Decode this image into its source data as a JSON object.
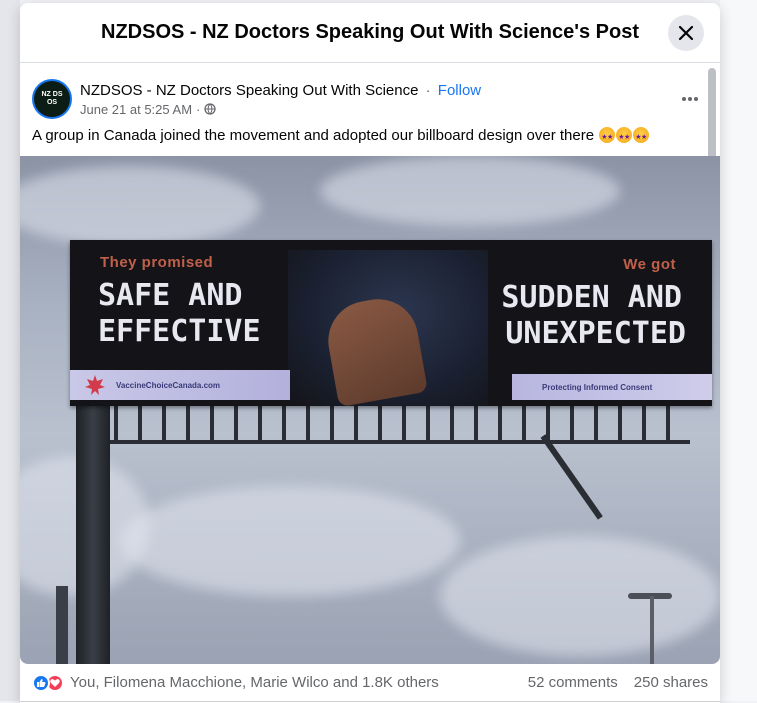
{
  "modal": {
    "title": "NZDSOS - NZ Doctors Speaking Out With Science's Post"
  },
  "post": {
    "author": "NZDSOS - NZ Doctors Speaking Out With Science",
    "separator": "·",
    "follow_label": "Follow",
    "timestamp": "June 21 at 5:25 AM",
    "meta_separator": "·",
    "text": "A group in Canada joined the movement and adopted our billboard design over there",
    "emoji_count": 3,
    "avatar_text": "NZ DS OS"
  },
  "billboard": {
    "left_small": "They promised",
    "left_big_1": "SAFE AND",
    "left_big_2": "EFFECTIVE",
    "right_small": "We got",
    "right_big_1": "SUDDEN AND",
    "right_big_2": "UNEXPECTED",
    "left_strip": "VaccineChoiceCanada.com",
    "right_strip": "Protecting Informed Consent"
  },
  "footer": {
    "reactors": "You, Filomena Macchione, Marie Wilco and 1.8K others",
    "comments": "52 comments",
    "shares": "250 shares"
  },
  "colors": {
    "accent": "#1877f2",
    "love": "#f33e58",
    "billboard_red": "#c0604a"
  }
}
